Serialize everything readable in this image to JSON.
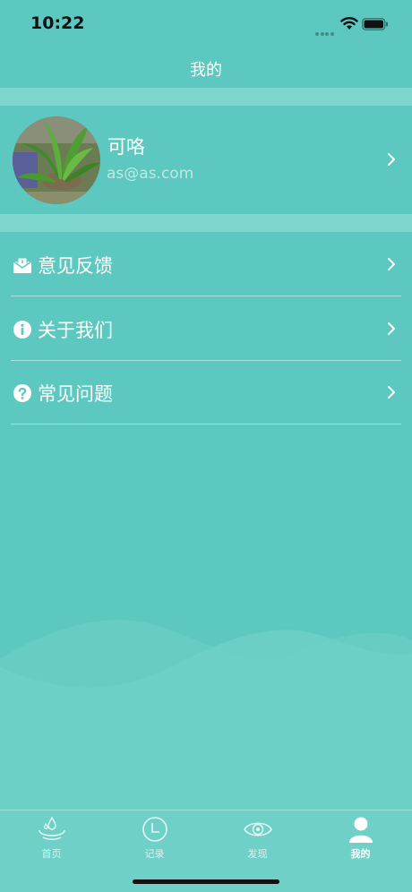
{
  "status_bar": {
    "time": "10:22"
  },
  "nav": {
    "title": "我的"
  },
  "profile": {
    "name": "可咯",
    "email": "as@as.com"
  },
  "menu": [
    {
      "label": "意见反馈",
      "icon": "mail-icon"
    },
    {
      "label": "关于我们",
      "icon": "info-icon"
    },
    {
      "label": "常见问题",
      "icon": "question-icon"
    }
  ],
  "tabs": [
    {
      "label": "首页",
      "icon": "water-drop-icon"
    },
    {
      "label": "记录",
      "icon": "clock-icon"
    },
    {
      "label": "发现",
      "icon": "eye-icon"
    },
    {
      "label": "我的",
      "icon": "person-icon"
    }
  ],
  "active_tab": "我的",
  "colors": {
    "background": "#5cc8c0",
    "section_gap": "#7fd6cf",
    "email": "#bfe8e4"
  }
}
